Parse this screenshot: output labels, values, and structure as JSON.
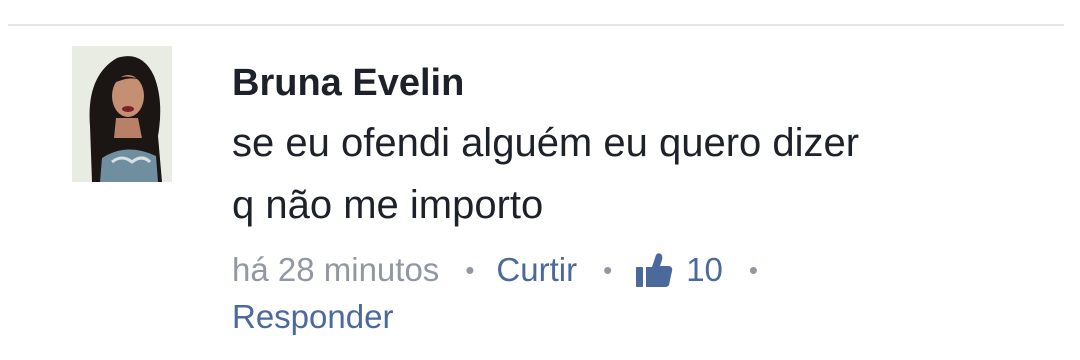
{
  "comment": {
    "author": "Bruna Evelin",
    "text_lines": [
      "se eu ofendi alguém eu quero dizer",
      "q não me importo"
    ],
    "timestamp": "há 28 minutos",
    "like_action": "Curtir",
    "like_count": "10",
    "reply_action": "Responder",
    "separator": "•"
  },
  "icons": {
    "like": "thumbs-up-icon"
  },
  "colors": {
    "author_text": "#1d2129",
    "meta_gray": "#9197a3",
    "link_blue": "#4b6a9b"
  }
}
